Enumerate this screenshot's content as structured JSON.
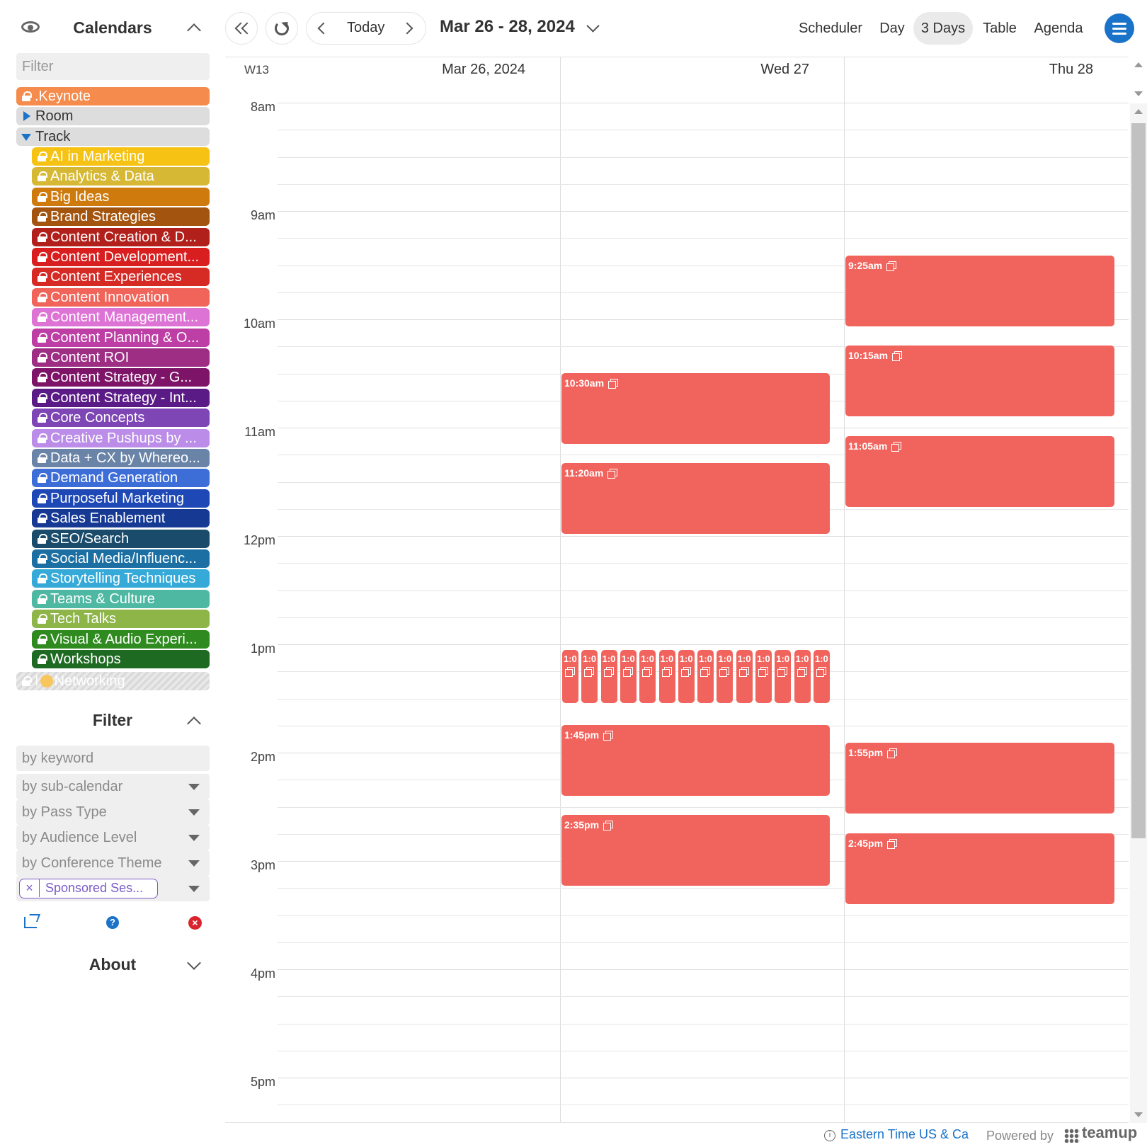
{
  "sidebar": {
    "calendars_title": "Calendars",
    "filter_placeholder": "Filter",
    "keynote": {
      "label": ".Keynote",
      "color": "#f58b4c"
    },
    "room": {
      "label": "Room"
    },
    "track": {
      "label": "Track"
    },
    "tracks": [
      {
        "label": "AI in Marketing",
        "color": "#f6c314"
      },
      {
        "label": "Analytics & Data",
        "color": "#d6b834"
      },
      {
        "label": "Big Ideas",
        "color": "#cf7a0c"
      },
      {
        "label": "Brand Strategies",
        "color": "#a3550f"
      },
      {
        "label": "Content Creation & D...",
        "color": "#b1201b"
      },
      {
        "label": "Content Development...",
        "color": "#d81e1e"
      },
      {
        "label": "Content Experiences",
        "color": "#d62a25"
      },
      {
        "label": "Content Innovation",
        "color": "#f0645a"
      },
      {
        "label": "Content Management...",
        "color": "#de73d6"
      },
      {
        "label": "Content Planning & O...",
        "color": "#bd3ea4"
      },
      {
        "label": "Content ROI",
        "color": "#9e2d84"
      },
      {
        "label": "Content Strategy - G...",
        "color": "#7e1468"
      },
      {
        "label": "Content Strategy - Int...",
        "color": "#5a1b86"
      },
      {
        "label": "Core Concepts",
        "color": "#7e45b5"
      },
      {
        "label": "Creative Pushups by ...",
        "color": "#bb8de8"
      },
      {
        "label": "Data + CX by Whereo...",
        "color": "#6a84a8"
      },
      {
        "label": "Demand Generation",
        "color": "#3d6ed8"
      },
      {
        "label": "Purposeful Marketing",
        "color": "#1e48b5"
      },
      {
        "label": "Sales Enablement",
        "color": "#163a94"
      },
      {
        "label": "SEO/Search",
        "color": "#1a4b6b"
      },
      {
        "label": "Social Media/Influenc...",
        "color": "#1b6fa3"
      },
      {
        "label": "Storytelling Techniques",
        "color": "#35aad8"
      },
      {
        "label": "Teams & Culture",
        "color": "#4fb8a3"
      },
      {
        "label": "Tech Talks",
        "color": "#8db547"
      },
      {
        "label": "Visual & Audio Experi...",
        "color": "#2f8a1f"
      },
      {
        "label": "Workshops",
        "color": "#1e6a22"
      }
    ],
    "networking": {
      "prefix": "I",
      "label": "Networking"
    },
    "filter_title": "Filter",
    "filters": {
      "keyword": "by keyword",
      "sub_calendar": "by sub-calendar",
      "pass_type": "by Pass Type",
      "audience": "by Audience Level",
      "theme": "by Conference Theme"
    },
    "tag": {
      "x": "×",
      "label": "Sponsored Ses..."
    },
    "help": "?",
    "clear": "×",
    "about_title": "About"
  },
  "toolbar": {
    "today": "Today",
    "range": "Mar 26 - 28, 2024",
    "views": [
      "Scheduler",
      "Day",
      "3 Days",
      "Table",
      "Agenda"
    ],
    "active_view": "3 Days"
  },
  "grid": {
    "week": "W13",
    "days": [
      "Mar 26, 2024",
      "Wed 27",
      "Thu 28"
    ],
    "hours": [
      "8am",
      "9am",
      "10am",
      "11am",
      "12pm",
      "1pm",
      "2pm",
      "3pm",
      "4pm",
      "5pm"
    ],
    "wed_events": [
      "10:30am",
      "11:20am",
      "1:45pm",
      "2:35pm"
    ],
    "thu_events": [
      "9:25am",
      "10:15am",
      "11:05am",
      "1:55pm",
      "2:45pm"
    ],
    "mini_label": "1:0",
    "mini_count": 14
  },
  "footer": {
    "info": "i",
    "timezone": "Eastern Time US & Ca",
    "powered": "Powered by",
    "brand": "teamup"
  }
}
